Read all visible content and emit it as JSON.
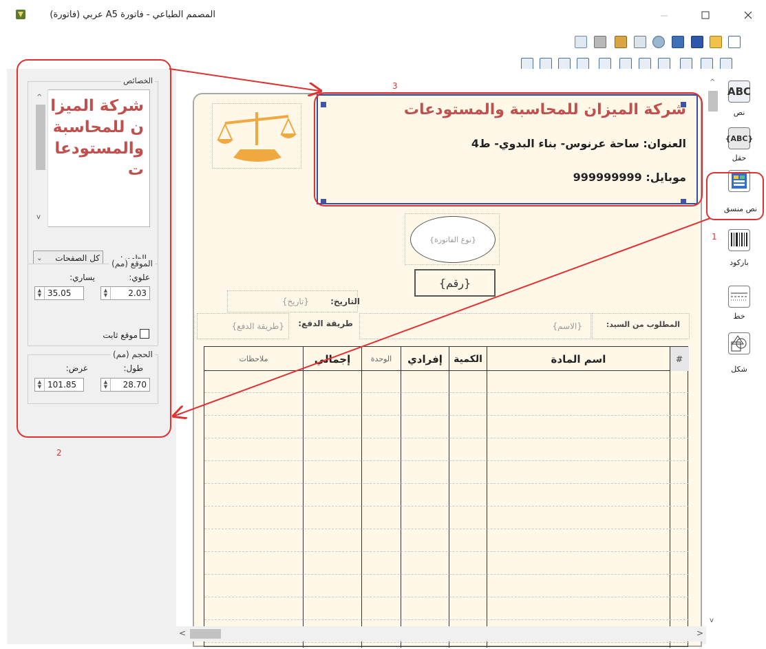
{
  "window": {
    "title": "المصمم الطباعي - فاتورة A5 عربي (فاتورة)"
  },
  "properties": {
    "group_title": "الخصائص",
    "preview_text": "شركة الميزان للمحاسبة والمستودعات",
    "visibility_label": "الظهور:",
    "visibility_value": "كل الصفحات",
    "position_title": "الموقع (مم)",
    "top_label": "علوي:",
    "left_label": "يساري:",
    "top_value": "2.03",
    "left_value": "35.05",
    "fixed_label": "موقع ثابت",
    "size_title": "الحجم (مم)",
    "height_label": "طول:",
    "width_label": "عرض:",
    "height_value": "28.70",
    "width_value": "101.85"
  },
  "invoice": {
    "company_name": "شركة الميزان للمحاسبة والمستودعات",
    "address": "العنوان: ساحة عرنوس- بناء البدوي- ط4",
    "mobile": "موبايل: 999999999",
    "invoice_type": "{نوع الفاتورة}",
    "invoice_number": "{رقم}",
    "date_label": "التاريخ:",
    "date_value": "{تاريخ}",
    "payment_label": "طريقة الدفع:",
    "payment_value": "{طريقة الدفع}",
    "customer_label": "المطلوب من السيد:",
    "customer_value": "{الاسم}",
    "columns": [
      "#",
      "اسم المادة",
      "الكمية",
      "إفرادي",
      "الوحدة",
      "إجمالي",
      "ملاحظات"
    ]
  },
  "tools": {
    "text_label": "نص",
    "text_icon": "ABC",
    "field_label": "حقل",
    "field_icon": "{ABC}",
    "formatted_label": "نص منسق",
    "barcode_label": "باركود",
    "line_label": "خط",
    "shape_label": "شكل"
  },
  "annotations": {
    "n1": "1",
    "n2": "2",
    "n3": "3"
  },
  "colors": {
    "accent_red": "#e03030",
    "company_red": "#c0504d",
    "selection_blue": "#2f4fa3",
    "page_bg": "#fff8e8"
  }
}
